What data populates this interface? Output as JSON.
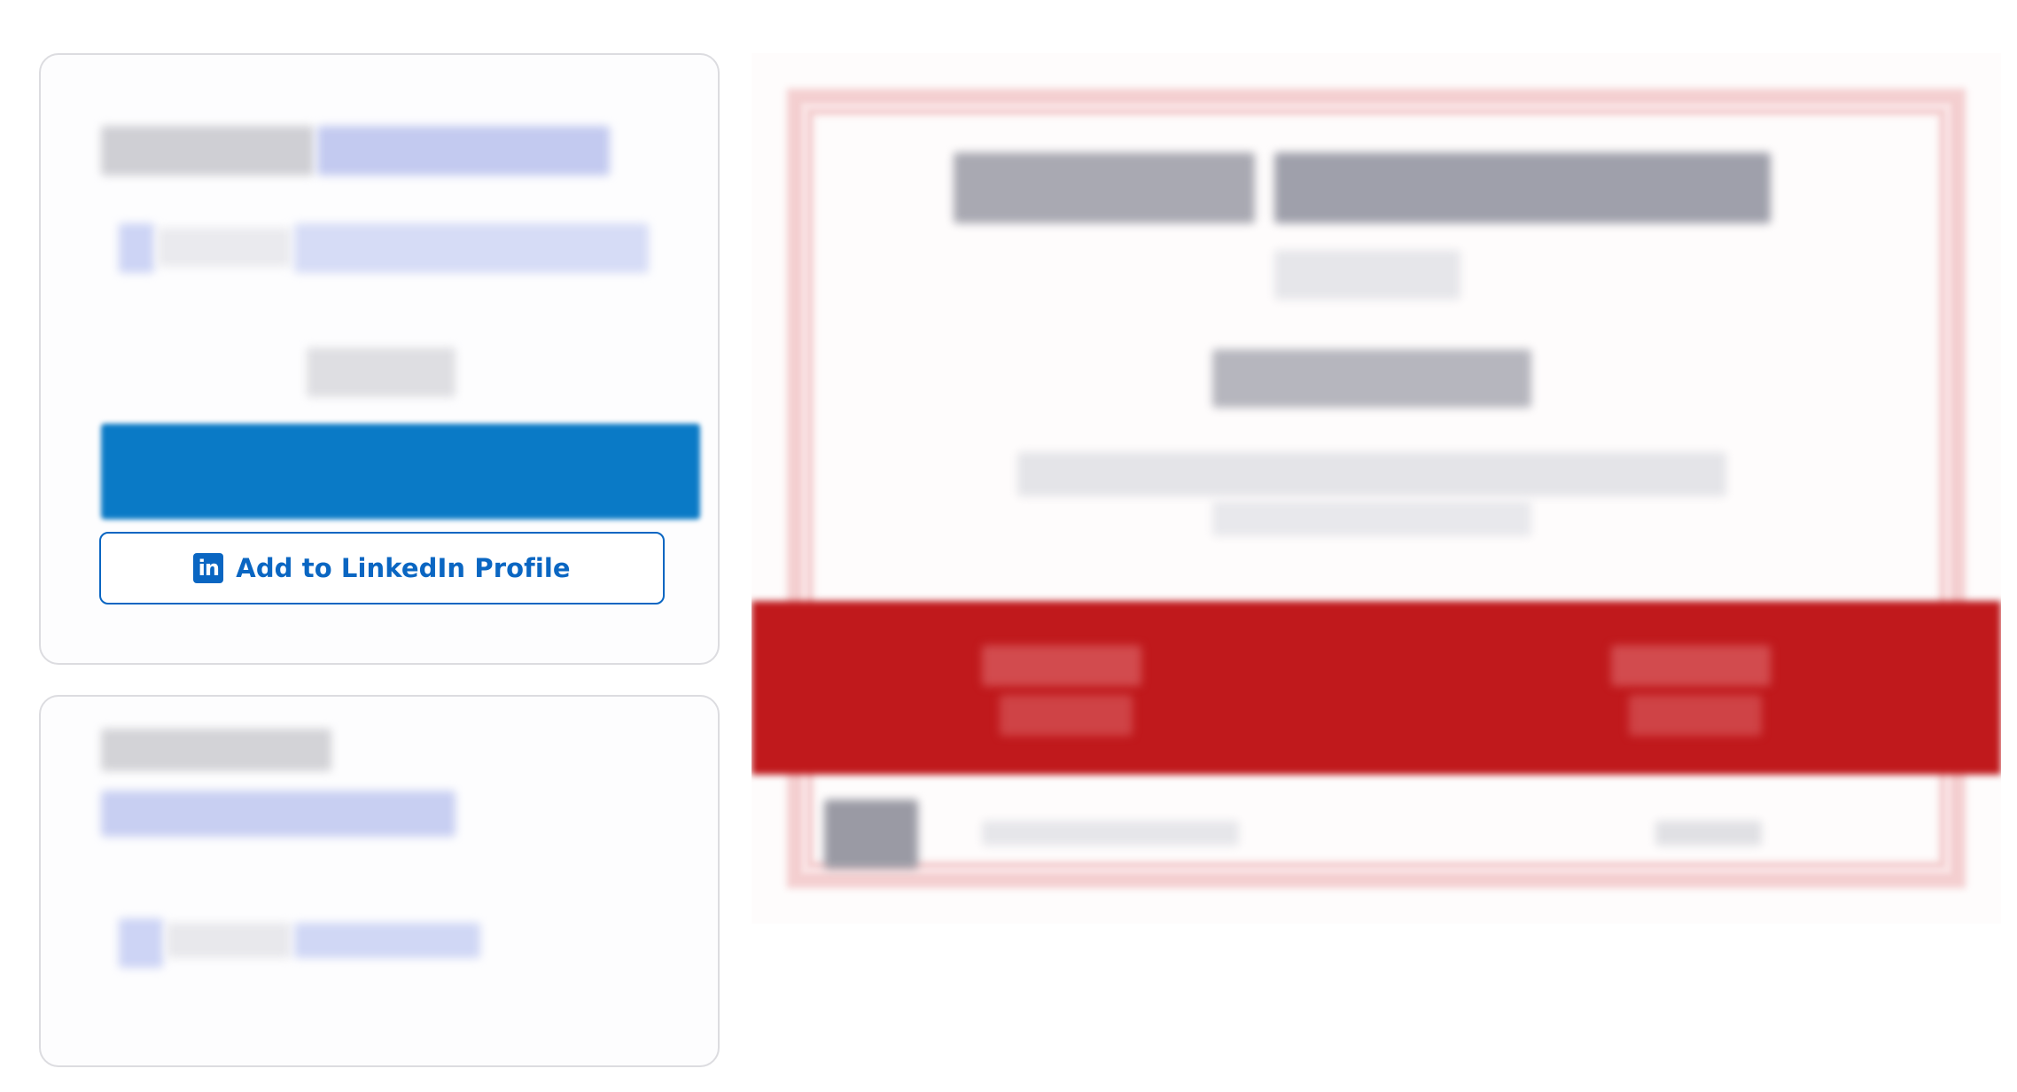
{
  "linkedin_button": {
    "label": "Add to LinkedIn Profile",
    "icon": "linkedin-icon",
    "icon_text": "in",
    "color": "#0a66c2"
  },
  "colors": {
    "certificate_band": "#c0191c",
    "certificate_border": "#f4cfd0",
    "primary_bar": "#0a7ac6"
  }
}
